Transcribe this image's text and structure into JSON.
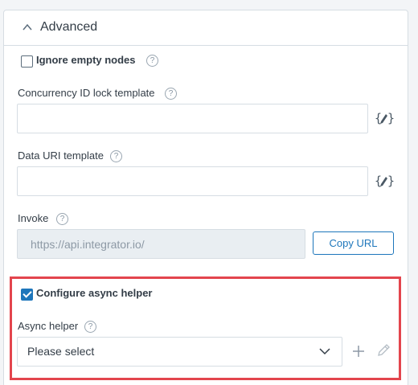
{
  "section": {
    "title": "Advanced",
    "collapse_icon": "chevron-up-icon"
  },
  "ignore_empty_nodes": {
    "label": "Ignore empty nodes",
    "checked": false
  },
  "concurrency_lock": {
    "label": "Concurrency ID lock template",
    "value": ""
  },
  "data_uri": {
    "label": "Data URI template",
    "value": ""
  },
  "invoke": {
    "label": "Invoke",
    "value": "https://api.integrator.io/",
    "copy_label": "Copy URL"
  },
  "async": {
    "checkbox_label": "Configure async helper",
    "checked": true,
    "helper_label": "Async helper",
    "helper_value": "Please select"
  },
  "colors": {
    "accent": "#1d76bb",
    "highlight_border": "#e3454d"
  }
}
